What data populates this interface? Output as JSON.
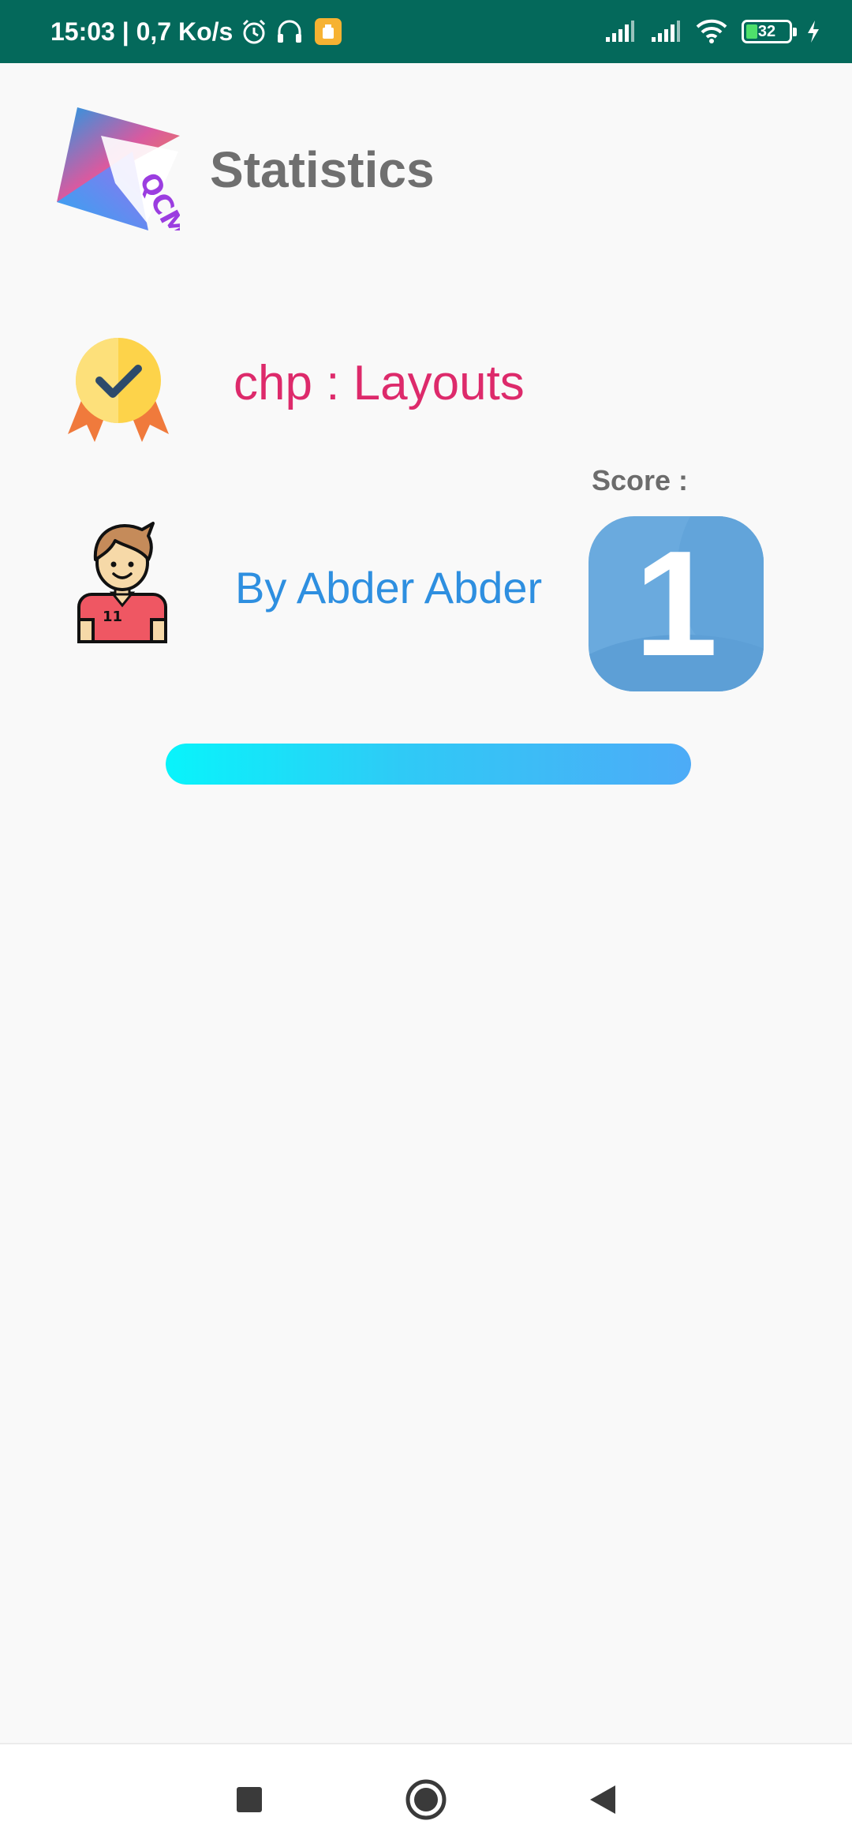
{
  "status_bar": {
    "time_speed": "15:03 | 0,7 Ko/s",
    "battery": "32",
    "icons": [
      "alarm-icon",
      "headset-icon",
      "app-notification-icon",
      "signal-icon",
      "signal-icon",
      "wifi-icon",
      "battery-icon",
      "charging-icon"
    ]
  },
  "header": {
    "logo_text": "QCM",
    "title": "Statistics"
  },
  "chapter": {
    "icon": "medal-check-icon",
    "label": "chp : Layouts"
  },
  "user": {
    "icon": "user-avatar-icon",
    "name": "By Abder Abder"
  },
  "score": {
    "label": "Score :",
    "value": "1"
  },
  "progress": {
    "fraction": 1.0
  },
  "nav_bar": {
    "buttons": [
      "recents-button",
      "home-button",
      "back-button"
    ]
  },
  "colors": {
    "status_bar": "#04695b",
    "title": "#6f6f6f",
    "chapter": "#dd2a6b",
    "user": "#2e8fe0",
    "score_box": "#6aaade"
  }
}
